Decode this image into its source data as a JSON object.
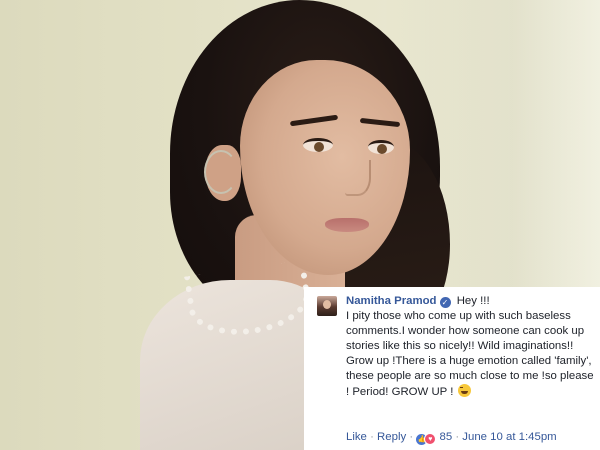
{
  "comment": {
    "author": "Namitha Pramod",
    "verified_icon": "verified-badge-icon",
    "greeting": "Hey !!!",
    "text": "I pity those who come up with such baseless comments.I wonder how someone can cook up stories like this so nicely!! Wild imaginations!! Grow up !There is a huge emotion called 'family', these people are so much close to me !so please ! Period! GROW UP !",
    "emoji_icon": "laughing-emoji-icon",
    "actions": {
      "like": "Like",
      "separator": "·",
      "reply": "Reply",
      "reaction_count": "85",
      "timestamp": "June 10 at 1:45pm"
    }
  },
  "colors": {
    "link": "#365899",
    "meta": "#90949c",
    "text": "#1d2129"
  }
}
